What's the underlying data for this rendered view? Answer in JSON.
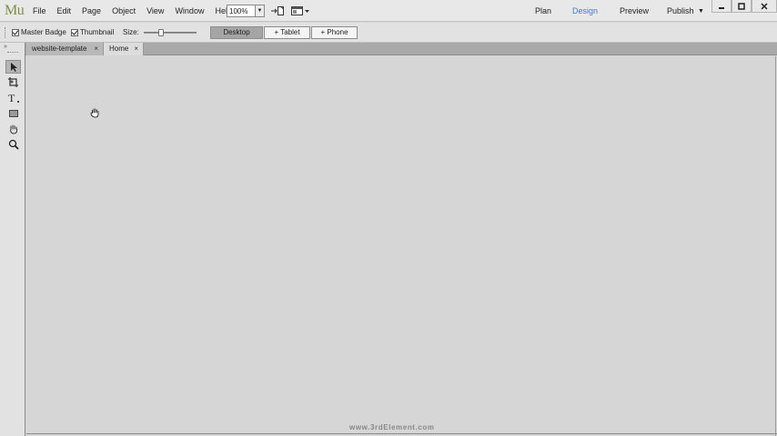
{
  "app": {
    "logo": "Mu"
  },
  "menu": [
    "File",
    "Edit",
    "Page",
    "Object",
    "View",
    "Window",
    "Help"
  ],
  "zoom": {
    "value": "100%"
  },
  "modes": {
    "plan": "Plan",
    "design": "Design",
    "preview": "Preview",
    "publish": "Publish"
  },
  "window_controls": {
    "minimize": "–",
    "maximize": "□",
    "close": "×"
  },
  "options": {
    "master_badge": "Master Badge",
    "thumbnail": "Thumbnail",
    "size_label": "Size:",
    "size_slider_fraction": 0.3,
    "layouts": {
      "desktop": "Desktop",
      "tablet": "+ Tablet",
      "phone": "+ Phone"
    }
  },
  "tabs": [
    {
      "label": "website-template",
      "close": "×"
    },
    {
      "label": "Home",
      "close": "×"
    }
  ],
  "tools": [
    "selection-tool",
    "crop-tool",
    "text-tool",
    "rectangle-tool",
    "hand-tool",
    "zoom-tool"
  ],
  "colors": {
    "active_mode": "#3c7fc4",
    "logo": "#7f8d4a",
    "canvas": "#d6d6d6"
  },
  "watermark": "www.3rdElement.com"
}
